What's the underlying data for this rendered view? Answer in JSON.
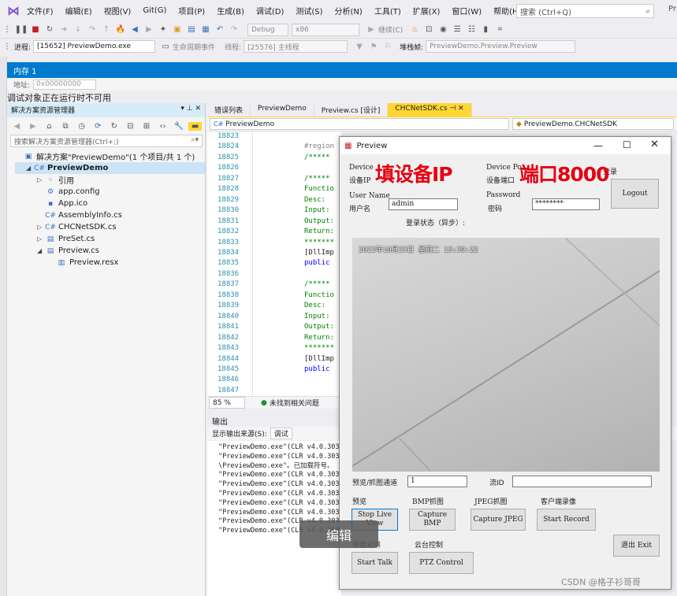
{
  "menubar": {
    "items": [
      "文件(F)",
      "编辑(E)",
      "视图(V)",
      "Git(G)",
      "项目(P)",
      "生成(B)",
      "调试(D)",
      "测试(S)",
      "分析(N)",
      "工具(T)",
      "扩展(X)",
      "窗口(W)",
      "帮助(H)"
    ],
    "search_placeholder": "搜索 (Ctrl+Q)",
    "cut_text": "Pr"
  },
  "toolbar": {
    "config": "Debug",
    "platform": "x86",
    "continue_label": "继续(C)",
    "process_label": "进程:",
    "process_value": "[15652] PreviewDemo.exe",
    "lifecycle_label": "生命周期事件",
    "thread_label": "线程:",
    "thread_value": "[25576] 主线程",
    "stackframe_label": "堆栈帧:",
    "stackframe_value": "PreviewDemo.Preview.Preview"
  },
  "memory": {
    "title": "内存 1",
    "address_label": "地址:",
    "address_value": "0x00000000",
    "debug_message": "调试对象正在运行时不可用"
  },
  "solution_explorer": {
    "title": "解决方案资源管理器",
    "search_placeholder": "搜索解决方案资源管理器(Ctrl+;)",
    "items": [
      {
        "label": "解决方案\"PreviewDemo\"(1 个项目/共 1 个)",
        "icon": "solution-icon",
        "indent": 0
      },
      {
        "label": "PreviewDemo",
        "icon": "csharp-project-icon",
        "indent": 1,
        "bold": true
      },
      {
        "label": "引用",
        "icon": "references-icon",
        "indent": 2
      },
      {
        "label": "app.config",
        "icon": "config-file-icon",
        "indent": 2
      },
      {
        "label": "App.ico",
        "icon": "ico-file-icon",
        "indent": 2
      },
      {
        "label": "AssemblyInfo.cs",
        "icon": "csharp-file-icon",
        "indent": 2
      },
      {
        "label": "CHCNetSDK.cs",
        "icon": "csharp-file-icon",
        "indent": 2
      },
      {
        "label": "PreSet.cs",
        "icon": "form-file-icon",
        "indent": 2
      },
      {
        "label": "Preview.cs",
        "icon": "form-file-icon",
        "indent": 2
      },
      {
        "label": "Preview.resx",
        "icon": "resx-file-icon",
        "indent": 3
      }
    ]
  },
  "editor": {
    "tabs": [
      "错误列表",
      "PreviewDemo",
      "Preview.cs [设计]",
      "CHCNetSDK.cs"
    ],
    "nav_left": "PreviewDemo",
    "nav_right": "PreviewDemo.CHCNetSDK",
    "line_numbers": [
      "18823",
      "18824",
      "18825",
      "18826",
      "18827",
      "18828",
      "18829",
      "18830",
      "18831",
      "18832",
      "18833",
      "18834",
      "18835",
      "18836",
      "18837",
      "18838",
      "18839",
      "18840",
      "18841",
      "18842",
      "18843",
      "18844",
      "18845",
      "18846",
      "18847"
    ],
    "code_lines": [
      "",
      "#region",
      "/*****",
      "",
      "/*****",
      "Functio",
      "Desc:",
      "Input:",
      "Output:",
      "Return:",
      "*******",
      "[DllImp",
      "public ",
      "",
      "/*****",
      "Functio",
      "Desc:",
      "Input:",
      "Output:",
      "Return:",
      "*******",
      "[DllImp",
      "public ",
      "",
      ""
    ],
    "zoom": "85 %",
    "issues": "未找到相关问题"
  },
  "output": {
    "title": "输出",
    "source_label": "显示输出来源(S):",
    "source_value": "调试",
    "lines": [
      "\"PreviewDemo.exe\"(CLR v4.0.3031",
      "\"PreviewDemo.exe\"(CLR v4.0.3031",
      "\\PreviewDemo.exe\"。已加载符号。",
      "\"PreviewDemo.exe\"(CLR v4.0.3031",
      "\"PreviewDemo.exe\"(CLR v4.0.3031",
      "\"PreviewDemo.exe\"(CLR v4.0.3031",
      "\"PreviewDemo.exe\"(CLR v4.0.3031",
      "\"PreviewDemo.exe\"(CLR v4.0.3031",
      "\"PreviewDemo.exe\"(CLR v4.0.3031",
      "\"PreviewDemo.exe\"(CLR v4.0.3031"
    ]
  },
  "preview_window": {
    "title": "Preview",
    "device_ip_en": "Device",
    "device_ip_cn": "设备IP",
    "device_port_en": "Device Po",
    "device_port_cn": "设备端口",
    "user_name_en": "User Name",
    "user_name_cn": "用户名",
    "password_en": "Password",
    "password_cn": "密码",
    "username_value": "admin",
    "password_value": "********",
    "login_label": "登录",
    "logout_label": "Logout",
    "login_status": "登录状态（异步）:",
    "annotation_ip": "填设备IP",
    "annotation_port": "端口8000",
    "video_timestamp": "2022年10月25日  星期二 15:39:22",
    "channel_label": "预览/抓图通道",
    "channel_value": "1",
    "stream_label": "流ID",
    "section_preview": "预览",
    "section_bmp": "BMP抓图",
    "section_jpeg": "JPEG抓图",
    "section_record": "客户端录像",
    "btn_stop_live": "Stop Live View",
    "btn_capture_bmp": "Capture BMP",
    "btn_capture_jpeg": "Capture JPEG",
    "btn_start_record": "Start Record",
    "btn_exit": "退出 Exit",
    "section_voice": "语音对讲",
    "section_ptz": "云台控制",
    "btn_start_talk": "Start Talk",
    "btn_ptz": "PTZ Control"
  },
  "overlay": {
    "edit_badge": "编辑",
    "watermark": "CSDN @格子衫哥哥"
  },
  "colors": {
    "accent": "#007acc",
    "tab_active": "#ffd633",
    "annotation": "#e60012"
  }
}
